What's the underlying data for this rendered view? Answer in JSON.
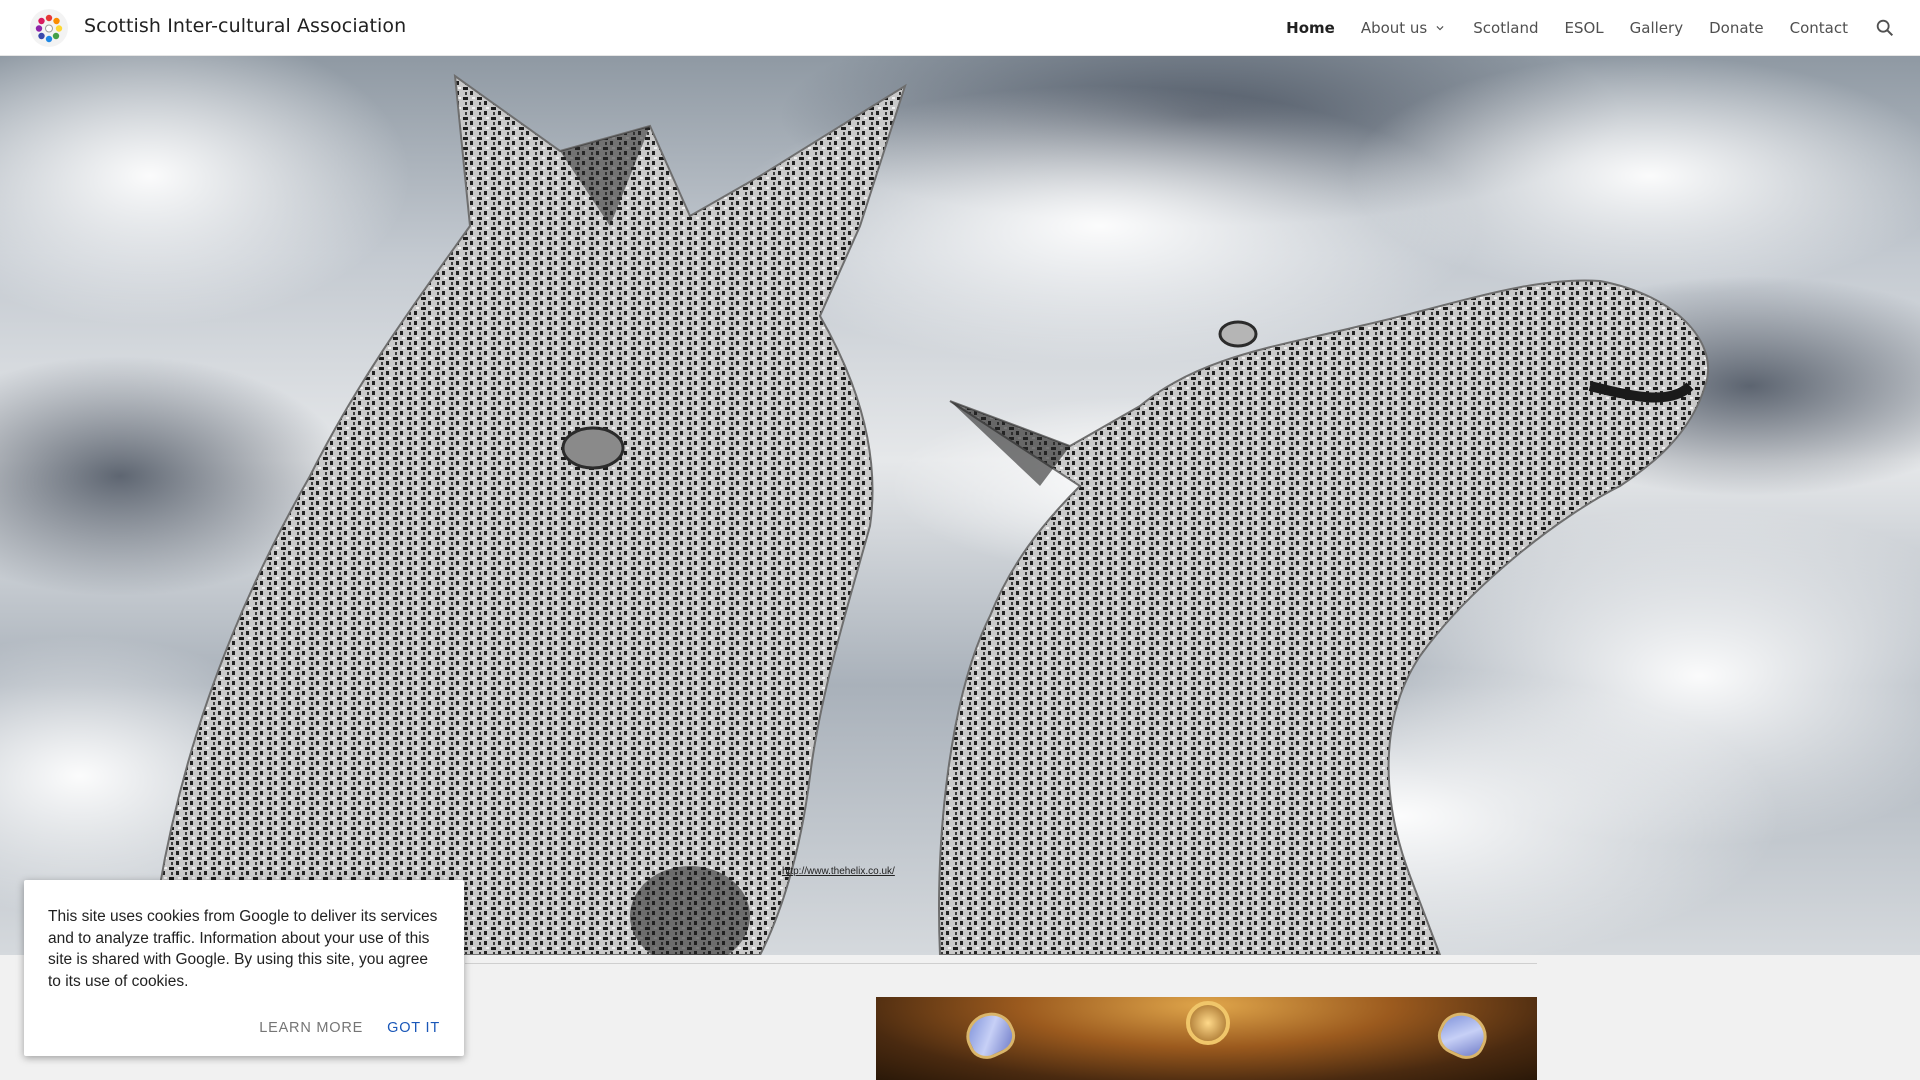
{
  "header": {
    "site_title": "Scottish Inter-cultural Association",
    "nav": [
      {
        "label": "Home",
        "active": true
      },
      {
        "label": "About us",
        "has_dropdown": true
      },
      {
        "label": "Scotland"
      },
      {
        "label": "ESOL"
      },
      {
        "label": "Gallery"
      },
      {
        "label": "Donate"
      },
      {
        "label": "Contact"
      }
    ],
    "search_icon": "search-icon",
    "dropdown_icon": "chevron-down-icon"
  },
  "hero": {
    "image": "kelpies-horse-head-sculptures",
    "credit_link": "http://www.thehelix.co.uk/"
  },
  "content": {
    "image": "ornate-painted-ceiling"
  },
  "cookie_notice": {
    "text": "This site uses cookies from Google to deliver its services and to analyze traffic. Information about your use of this site is shared with Google. By using this site, you agree to its use of cookies.",
    "learn_more_label": "LEARN MORE",
    "got_it_label": "GOT IT"
  },
  "colors": {
    "link_accent": "#1a57b8",
    "secondary_text": "#757575"
  }
}
